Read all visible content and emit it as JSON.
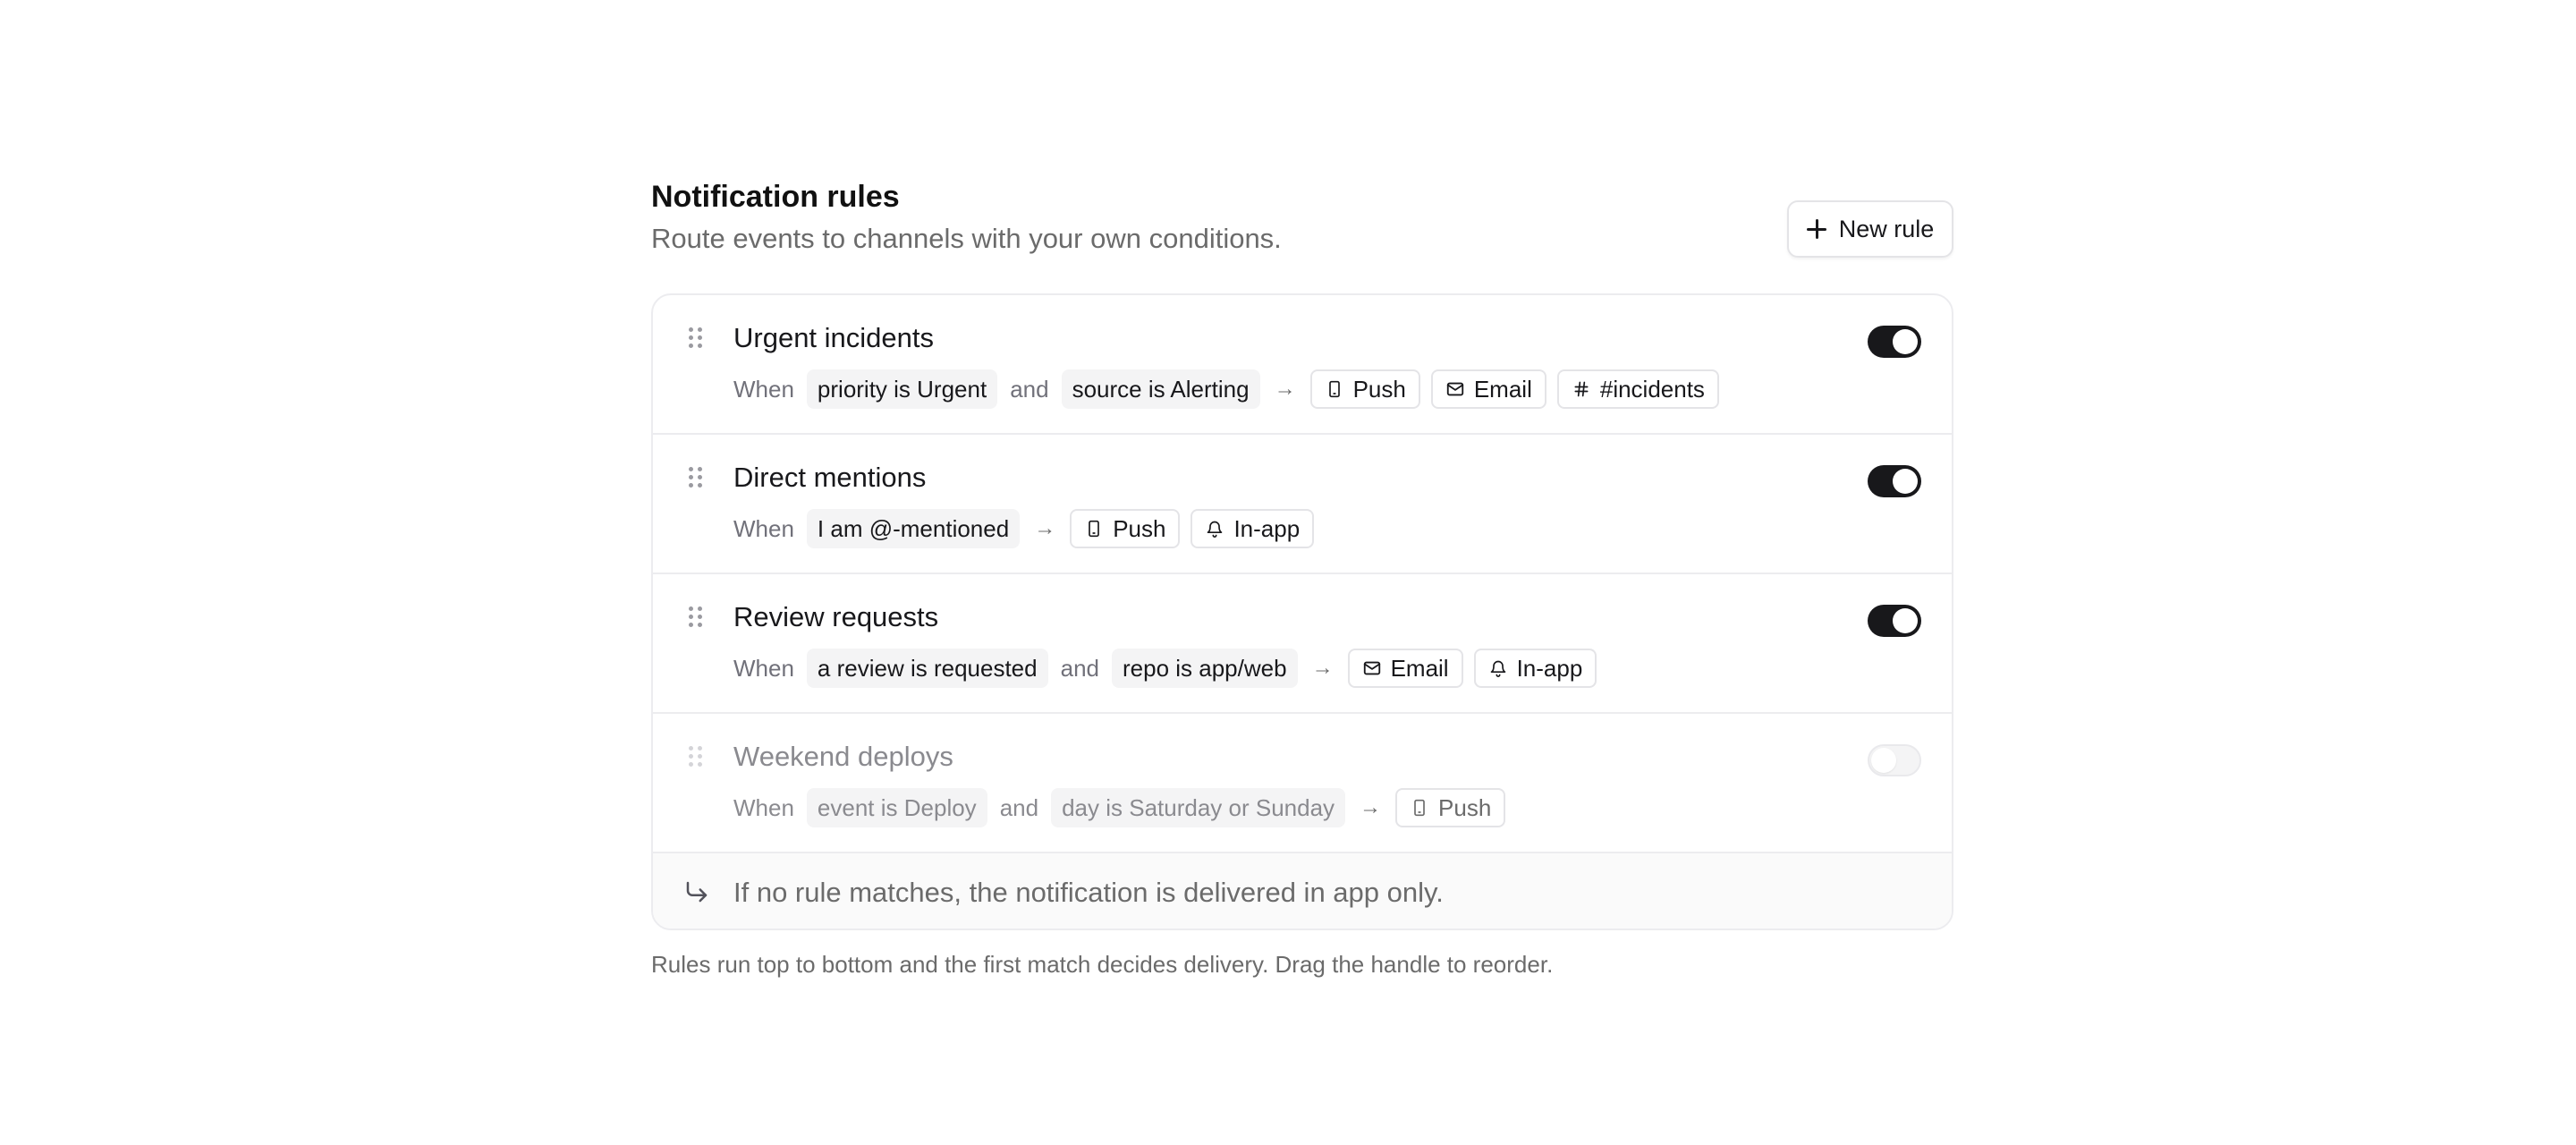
{
  "header": {
    "title": "Notification rules",
    "subtitle": "Route events to channels with your own conditions.",
    "new_rule_label": "New rule",
    "new_rule_icon": "plus-icon"
  },
  "rules": [
    {
      "name": "Urgent incidents",
      "enabled": true,
      "when_label": "When",
      "conditions": [
        "priority is Urgent",
        "source is Alerting"
      ],
      "joiner": "and",
      "channels": [
        {
          "icon": "phone-icon",
          "label": "Push"
        },
        {
          "icon": "mail-icon",
          "label": "Email"
        },
        {
          "icon": "hash-icon",
          "label": "#incidents"
        }
      ]
    },
    {
      "name": "Direct mentions",
      "enabled": true,
      "when_label": "When",
      "conditions": [
        "I am @-mentioned"
      ],
      "channels": [
        {
          "icon": "phone-icon",
          "label": "Push"
        },
        {
          "icon": "bell-icon",
          "label": "In-app"
        }
      ]
    },
    {
      "name": "Review requests",
      "enabled": true,
      "when_label": "When",
      "conditions": [
        "a review is requested",
        "repo is app/web"
      ],
      "joiner": "and",
      "channels": [
        {
          "icon": "mail-icon",
          "label": "Email"
        },
        {
          "icon": "bell-icon",
          "label": "In-app"
        }
      ]
    },
    {
      "name": "Weekend deploys",
      "enabled": false,
      "when_label": "When",
      "conditions": [
        "event is Deploy",
        "day is Saturday or Sunday"
      ],
      "joiner": "and",
      "channels": [
        {
          "icon": "phone-icon",
          "label": "Push"
        }
      ]
    }
  ],
  "fallback": {
    "icon": "corner-down-right-icon",
    "text": "If no rule matches, the notification is delivered in app only."
  },
  "footnote": "Rules run top to bottom and the first match decides delivery. Drag the handle to reorder.",
  "colors": {
    "toggle_on": "#18181b",
    "chip_bg": "#f4f4f5",
    "border": "#ececef",
    "muted_text": "#6b6b6b"
  }
}
